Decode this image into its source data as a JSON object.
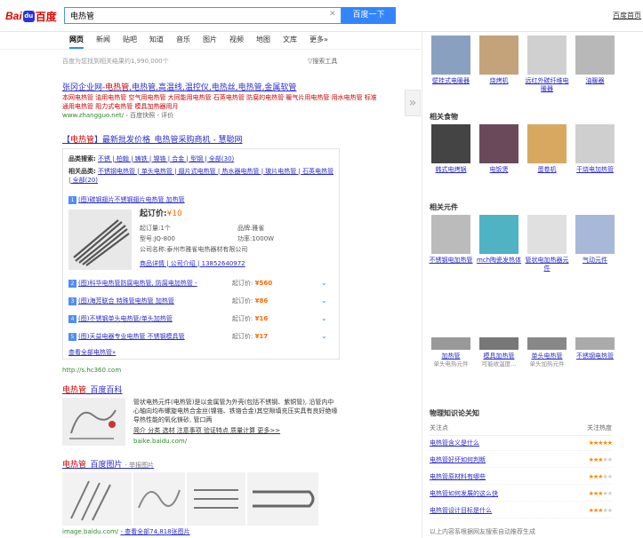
{
  "header": {
    "logo_bai": "Bai",
    "logo_paw": "du",
    "logo_du": "百度",
    "query": "电热管",
    "search_button": "百度一下",
    "top_right": "百度首页"
  },
  "tabs": [
    "网页",
    "新闻",
    "贴吧",
    "知道",
    "音乐",
    "图片",
    "视频",
    "地图",
    "文库",
    "更多»"
  ],
  "result_count": "百度为您找到相关结果约1,990,000个",
  "search_tools": "搜索工具",
  "results": {
    "r1": {
      "title_a": "张冈企业网-",
      "title_hl": "电热管",
      "title_b": ",电热管,高温线,温控仪,电热丝,电热管,金属软管",
      "abstract": "本网电热管 油用电热管 空气用电热管 大同能用电热管 石英电热管 防腐的电热管 暖气片用电热管 用水电热管 标准通用电热管 阻力式电热管 模具加热器用月",
      "url": "www.zhangguo.net/",
      "url_extra": "- 百度快照 - 评价"
    },
    "r2": {
      "title_a": "【",
      "title_hl": "电热管",
      "title_b": "】最新批发价格_电热管采购商机 - 慧聪网"
    },
    "ad": {
      "row1_label": "品类搜索:",
      "row1_items": "不锈 | 柏翰 | 铸铁 | 镍铬 | 合金 | 型钢 | 全部(30)",
      "row2_label": "相关品类:",
      "row2_items": "不锈钢电热管 | 单头电热管 | 翅片式电热管 | 热水器电热管 | 玻片电热管 | 石英电热管 | 全部(20)",
      "featured_title": "(图)碳钢翅片不锈钢翅片电热管 加热管",
      "price_label": "起订价:",
      "price_value": "¥10",
      "min_order": "起订量:1个",
      "brand": "品牌:雅雀",
      "model": "型号:JQ-800",
      "power": "功率:1000W",
      "company": "公司名称:泰州市雅雀电热器材有限公司",
      "links": "商品详情 | 公司介绍 | 13852640972",
      "items": [
        {
          "n": "2",
          "t": "(图)科华电热管防腐电热管, 防腐电加热管 -",
          "pl": "起订价:",
          "p": "¥560"
        },
        {
          "n": "3",
          "t": "(图)海芳联合 特殊管电热管 加热管",
          "pl": "起订价:",
          "p": "¥86"
        },
        {
          "n": "4",
          "t": "(图)不锈钢单头电热管/单头加热管",
          "pl": "起订价:",
          "p": "¥16"
        },
        {
          "n": "5",
          "t": "(图)天益电器专业电热管 不锈钢模具管",
          "pl": "起订价:",
          "p": "¥17"
        }
      ],
      "more": "查看全部电热管»"
    },
    "r2_url": "http://s.hc360.com",
    "r3": {
      "title_hl": "电热管",
      "title_b": "_百度百科",
      "abstract": "管状电热元件(电热管)是以金属管为外壳(包括不锈钢、紫铜管), 沿管内中心轴向均布螺旋电热合金丝(镍铬、铁铬合金)其空隙填充压实具有良好绝缘导热性能的氧化镁砂, 管口两",
      "links": "简介 分类 选材 注意事项 验证特点 质量计算 更多>>",
      "url": "baike.baidu.com/"
    },
    "r4": {
      "title_hl": "电热管",
      "title_b": "_百度图片",
      "tag": "- 举报图片",
      "url": "image.baidu.com/",
      "url_extra": "- 查看全部74,818张图片"
    }
  },
  "right": {
    "row0": [
      {
        "cap": "壁挂式电暖器"
      },
      {
        "cap": "烧烤机"
      },
      {
        "cap": "远红外碳纤维电暖器"
      },
      {
        "cap": "油暖器"
      }
    ],
    "sec1_title": "相关食物",
    "row1": [
      {
        "cap": "韩式电烤锅"
      },
      {
        "cap": "电饭煲"
      },
      {
        "cap": "蛋卷机"
      },
      {
        "cap": "干烧电加热管"
      }
    ],
    "sec2_title": "相关元件",
    "row2": [
      {
        "cap": "不锈钢电加热管"
      },
      {
        "cap": "mch陶瓷发热体"
      },
      {
        "cap": "管状电加热器元件"
      },
      {
        "cap": "气动元件"
      }
    ],
    "row3": [
      {
        "cap": "加热管",
        "sub": "单头电热元件"
      },
      {
        "cap": "模具加热管",
        "sub": "可能收温度..."
      },
      {
        "cap": "单头电热管",
        "sub": "单头加热元件"
      },
      {
        "cap": "不锈钢电热管",
        "sub": ""
      }
    ],
    "know_title": "物理知识论关知",
    "know_head_l": "关注点",
    "know_head_r": "关注热度",
    "know": [
      {
        "t": "电热管含义是什么",
        "s": 5
      },
      {
        "t": "电热管好坏如何判断",
        "s": 3
      },
      {
        "t": "电热管原材料有哪些",
        "s": 3
      },
      {
        "t": "电热管如何发展的这么快",
        "s": 3
      },
      {
        "t": "电热管设计目标是什么",
        "s": 3
      }
    ],
    "know_foot": "以上内容系根据网友搜索自动推荐生成"
  }
}
